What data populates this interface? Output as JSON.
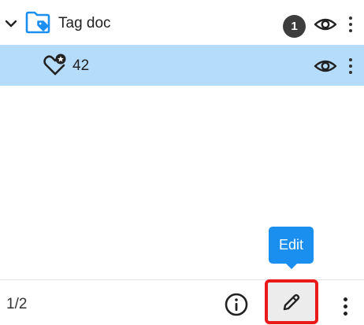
{
  "tree": {
    "folder": {
      "title": "Tag doc",
      "count": "1",
      "icon": "folder-tag-icon",
      "expand_icon": "chevron-down-icon",
      "visibility_icon": "eye-icon",
      "menu_icon": "more-vertical-icon"
    },
    "tag": {
      "label": "42",
      "icon": "tag-heart-star-icon",
      "visibility_icon": "eye-icon",
      "menu_icon": "more-vertical-icon",
      "selected_bg": "#b5dcfb"
    }
  },
  "footer": {
    "pager": "1/2",
    "info_icon": "info-icon",
    "edit_icon": "pencil-icon",
    "more_icon": "more-vertical-icon"
  },
  "tooltip": {
    "text": "Edit",
    "color": "#1a8ff0"
  },
  "colors": {
    "accent": "#1a8ff0",
    "highlight_border": "#ea1a1a",
    "badge": "#3d3d3d"
  }
}
